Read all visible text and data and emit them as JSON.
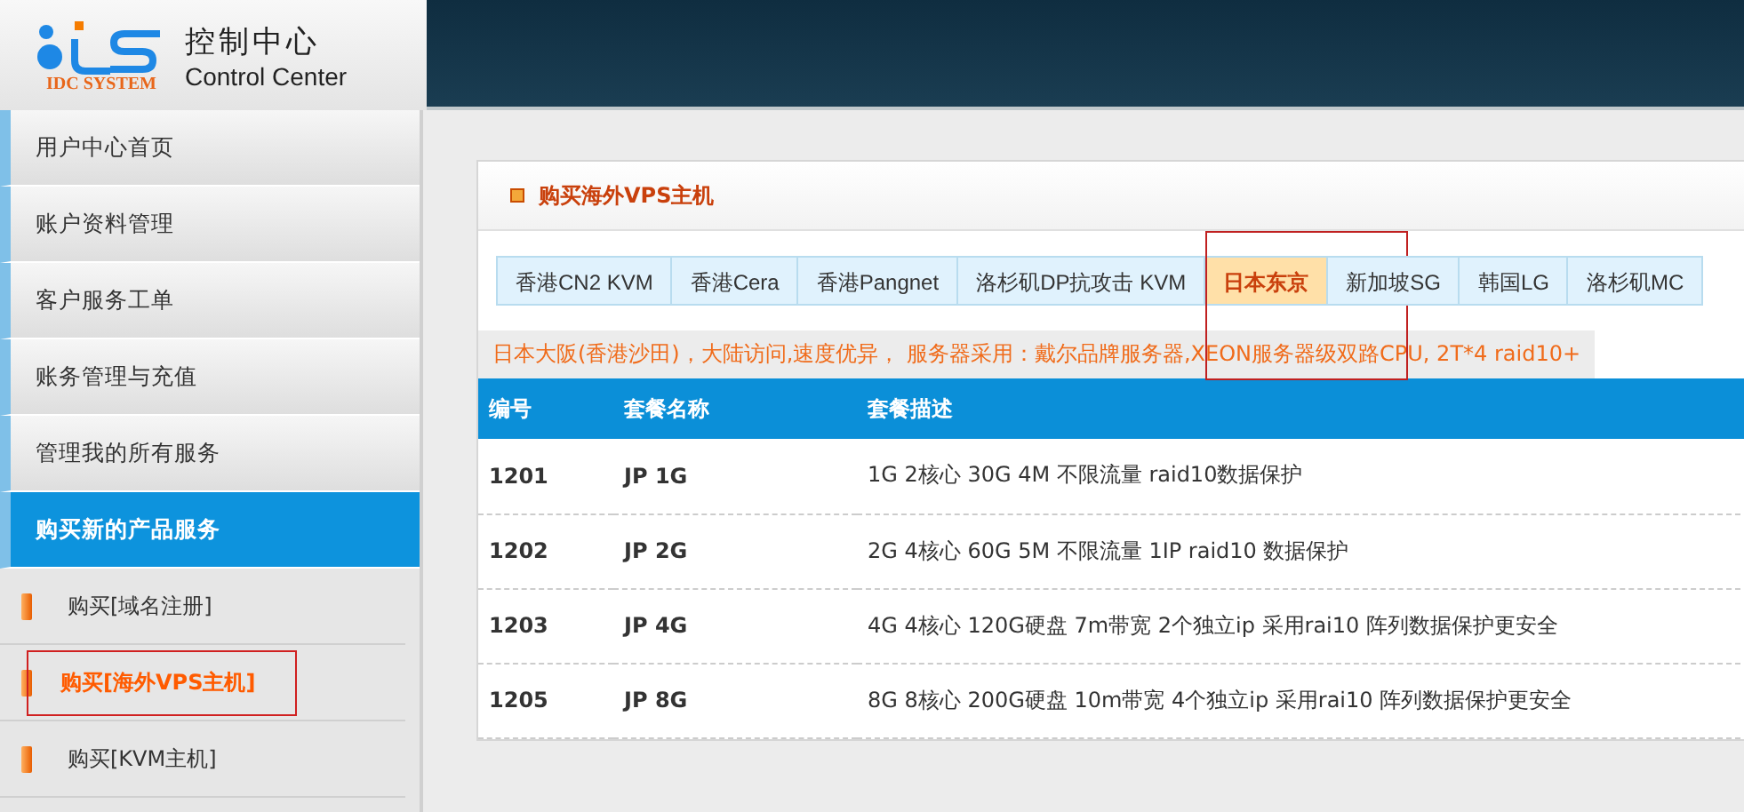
{
  "header": {
    "logo_text": "IDC SYSTEM",
    "title": "控制中心",
    "subtitle": "Control Center"
  },
  "sidebar": {
    "items": [
      {
        "label": "用户中心首页",
        "kind": "main",
        "selected": false,
        "annotated": false
      },
      {
        "label": "账户资料管理",
        "kind": "main",
        "selected": false,
        "annotated": false
      },
      {
        "label": "客户服务工单",
        "kind": "main",
        "selected": false,
        "annotated": false
      },
      {
        "label": "账务管理与充值",
        "kind": "main",
        "selected": false,
        "annotated": false
      },
      {
        "label": "管理我的所有服务",
        "kind": "main",
        "selected": false,
        "annotated": false
      },
      {
        "label": "购买新的产品服务",
        "kind": "main",
        "selected": true,
        "annotated": false
      },
      {
        "label": "购买[域名注册]",
        "kind": "sub",
        "selected": false,
        "annotated": false
      },
      {
        "label": "购买[海外VPS主机]",
        "kind": "sub",
        "selected": true,
        "annotated": true
      },
      {
        "label": "购买[KVM主机]",
        "kind": "sub",
        "selected": false,
        "annotated": false
      }
    ]
  },
  "panel": {
    "title": "购买海外VPS主机",
    "tabs": [
      {
        "label": "香港CN2 KVM",
        "selected": false,
        "annotated": false
      },
      {
        "label": "香港Cera",
        "selected": false,
        "annotated": false
      },
      {
        "label": "香港Pangnet",
        "selected": false,
        "annotated": false
      },
      {
        "label": "洛杉矶DP抗攻击 KVM",
        "selected": false,
        "annotated": false
      },
      {
        "label": "日本东京",
        "selected": true,
        "annotated": true
      },
      {
        "label": "新加坡SG",
        "selected": false,
        "annotated": false
      },
      {
        "label": "韩国LG",
        "selected": false,
        "annotated": false
      },
      {
        "label": "洛杉矶MC",
        "selected": false,
        "annotated": false
      }
    ],
    "notice": "日本大阪(香港沙田)，大陆访问,速度优异， 服务器采用：戴尔品牌服务器,XEON服务器级双路CPU, 2T*4 raid10+",
    "table": {
      "columns": [
        "编号",
        "套餐名称",
        "套餐描述"
      ],
      "rows": [
        [
          "1201",
          "JP 1G",
          "1G 2核心 30G 4M 不限流量 raid10数据保护"
        ],
        [
          "1202",
          "JP 2G",
          "2G 4核心 60G 5M 不限流量 1IP raid10 数据保护"
        ],
        [
          "1203",
          "JP 4G",
          "4G 4核心 120G硬盘 7m带宽 2个独立ip 采用rai10 阵列数据保护更安全"
        ],
        [
          "1205",
          "JP 8G",
          "8G 8核心 200G硬盘 10m带宽 4个独立ip 采用rai10 阵列数据保护更安全"
        ]
      ]
    }
  }
}
